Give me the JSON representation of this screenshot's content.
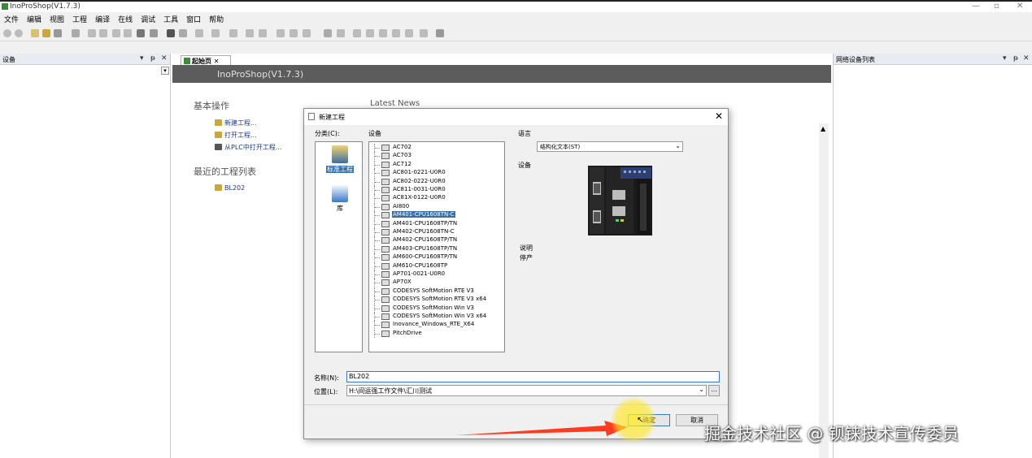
{
  "window": {
    "title": "InoProShop(V1.7.3)"
  },
  "menu": [
    "文件",
    "编辑",
    "视图",
    "工程",
    "编译",
    "在线",
    "调试",
    "工具",
    "窗口",
    "帮助"
  ],
  "left_pane": {
    "title": "设备"
  },
  "right_pane": {
    "title": "网络设备列表"
  },
  "doc": {
    "tab_label": "起始页",
    "banner": "InoProShop(V1.7.3)",
    "basic_ops_title": "基本操作",
    "links": [
      "新建工程...",
      "打开工程...",
      "从PLC中打开工程..."
    ],
    "recent_title": "最近的工程列表",
    "recent_items": [
      "BL202"
    ],
    "news_title": "Latest News"
  },
  "dialog": {
    "title": "新建工程",
    "category_label": "分类(C):",
    "device_label": "设备",
    "language_label": "语言",
    "device_preview_label": "设备",
    "description_label": "说明",
    "description_value": "停产",
    "categories": [
      "标准工程",
      "库"
    ],
    "devices": [
      "AC702",
      "AC703",
      "AC712",
      "AC801-0221-U0R0",
      "AC802-0222-U0R0",
      "AC811-0031-U0R0",
      "AC81X-0122-U0R0",
      "AI800",
      "AM401-CPU1608TN-C",
      "AM401-CPU1608TP/TN",
      "AM402-CPU1608TN-C",
      "AM402-CPU1608TP/TN",
      "AM403-CPU1608TP/TN",
      "AM600-CPU1608TP/TN",
      "AM610-CPU1608TP",
      "AP701-0021-U0R0",
      "AP70X",
      "CODESYS SoftMotion RTE V3",
      "CODESYS SoftMotion RTE V3 x64",
      "CODESYS SoftMotion Win V3",
      "CODESYS SoftMotion Win V3 x64",
      "Inovance_Windows_RTE_X64",
      "PitchDrive"
    ],
    "selected_device_index": 8,
    "language_value": "结构化文本(ST)",
    "name_label": "名称(N):",
    "name_value": "BL202",
    "location_label": "位置(L):",
    "location_value": "H:\\间运强工作文件\\汇川测试",
    "browse_label": "...",
    "ok_label": "确定",
    "cancel_label": "取消"
  },
  "watermark": "掘金技术社区 @ 钡铼技术宣传委员",
  "colors": {
    "banner": "#5c5c5c",
    "selection": "#3a6ea5",
    "highlight": "#ffe82a",
    "arrow": "#ff3b1f"
  }
}
